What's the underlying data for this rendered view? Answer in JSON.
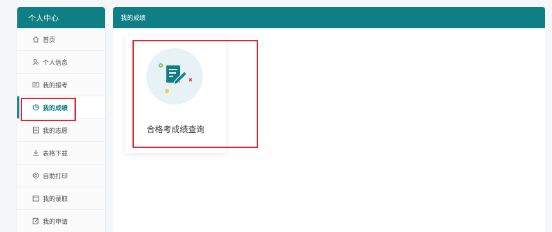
{
  "sidebar": {
    "title": "个人中心",
    "items": [
      {
        "label": "首页",
        "icon": "home-icon"
      },
      {
        "label": "个人信息",
        "icon": "user-icon"
      },
      {
        "label": "我的报考",
        "icon": "id-card-icon"
      },
      {
        "label": "我的成绩",
        "icon": "chart-icon",
        "active": true
      },
      {
        "label": "我的志愿",
        "icon": "document-icon"
      },
      {
        "label": "表格下载",
        "icon": "download-icon"
      },
      {
        "label": "自助打印",
        "icon": "printer-icon"
      },
      {
        "label": "我的录取",
        "icon": "calendar-icon"
      },
      {
        "label": "我的申请",
        "icon": "edit-icon"
      }
    ]
  },
  "main": {
    "title": "我的成绩",
    "card": {
      "label": "合格考成绩查询",
      "icon": "grade-report-icon"
    }
  },
  "colors": {
    "accent": "#0e7f84",
    "annotation": "#e0262c",
    "icon_bg": "#e7f2f7"
  }
}
